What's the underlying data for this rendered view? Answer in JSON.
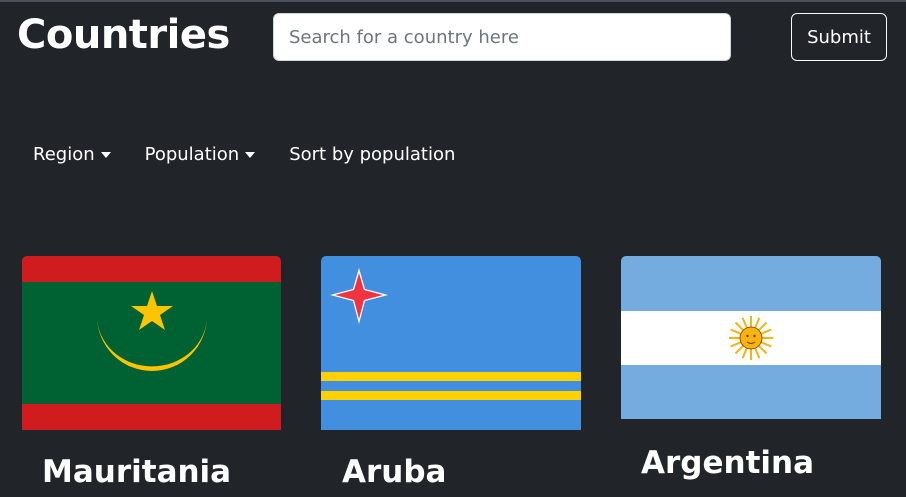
{
  "navbar": {
    "brand": "Countries",
    "search_placeholder": "Search for a country here",
    "submit_label": "Submit"
  },
  "filters": {
    "region_label": "Region",
    "population_label": "Population",
    "sort_label": "Sort by population"
  },
  "countries": [
    {
      "name": "Mauritania",
      "flag_icon": "mauritania-flag-icon",
      "colors": [
        "#006233",
        "#d01c1f",
        "#ffc400"
      ]
    },
    {
      "name": "Aruba",
      "flag_icon": "aruba-flag-icon",
      "colors": [
        "#418fde",
        "#ffd100",
        "#ef3340",
        "#ffffff"
      ]
    },
    {
      "name": "Argentina",
      "flag_icon": "argentina-flag-icon",
      "colors": [
        "#74acdf",
        "#ffffff",
        "#f6b40e"
      ]
    }
  ]
}
